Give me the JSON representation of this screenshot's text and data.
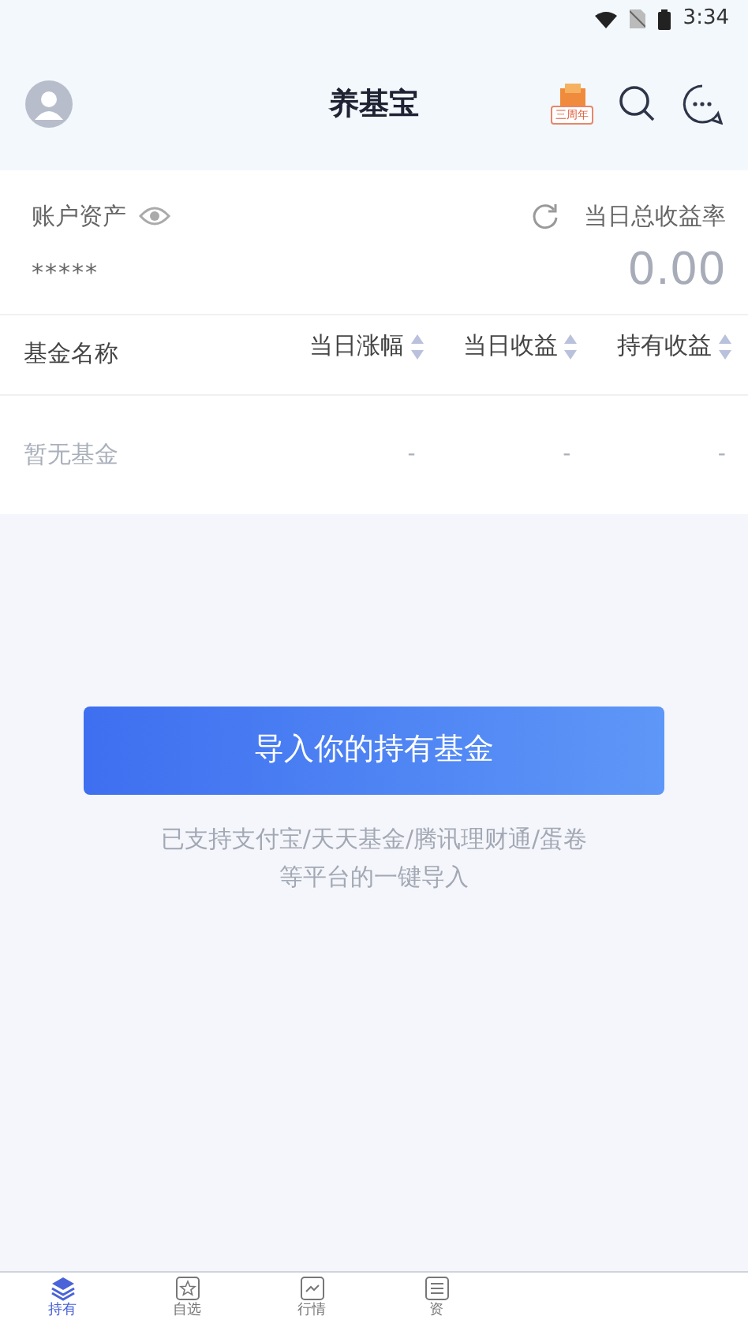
{
  "status_bar": {
    "time": "3:34"
  },
  "header": {
    "title": "养基宝",
    "badge": "三周年"
  },
  "summary": {
    "assets_label": "账户资产",
    "assets_value": "*****",
    "rate_label": "当日总收益率",
    "rate_value": "0.00"
  },
  "table": {
    "columns": [
      {
        "label": "基金名称",
        "kind": "plain"
      },
      {
        "label": "当日涨幅",
        "kind": "sortable"
      },
      {
        "label": "当日收益",
        "kind": "sortable"
      },
      {
        "label": "持有收益",
        "kind": "sortable"
      }
    ],
    "empty_row": [
      "暂无基金",
      "-",
      "-",
      "-"
    ]
  },
  "import_button": "导入你的持有基金",
  "import_note": [
    "已支持支付宝/天天基金/腾讯理财通/蛋卷",
    "等平台的一键导入"
  ],
  "tabs": [
    {
      "label": "持有",
      "selected": true
    },
    {
      "label": "自选",
      "selected": false
    },
    {
      "label": "行情",
      "selected": false
    },
    {
      "label": "资",
      "selected": false
    }
  ]
}
